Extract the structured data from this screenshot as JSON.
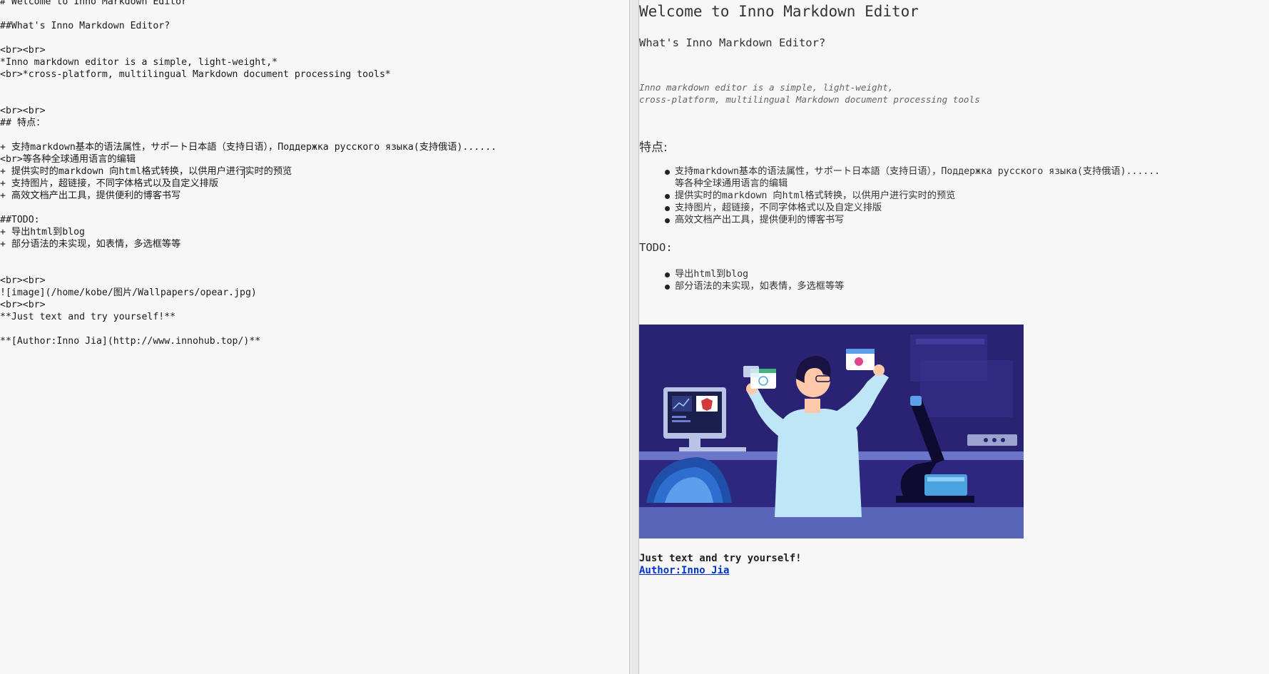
{
  "editor": {
    "lines": [
      "# Welcome to Inno Markdown Editor",
      "",
      "##What's Inno Markdown Editor?",
      "",
      "<br><br>",
      "*Inno markdown editor is a simple, light-weight,*",
      "<br>*cross-platform, multilingual Markdown document processing tools*",
      "",
      "",
      "<br><br>",
      "## 特点：",
      "",
      "+ 支持markdown基本的语法属性，サポート日本語（支持日语），Поддержка русского языка(支持俄语)......",
      "<br>等各种全球通用语言的编辑",
      "+ 提供实时的markdown 向html格式转换，以供用户进行实时的预览",
      "+ 支持图片，超链接，不同字体格式以及自定义排版",
      "+ 高效文档产出工具，提供便利的博客书写",
      "",
      "##TODO:",
      "+ 导出html到blog",
      "+ 部分语法的未实现，如表情，多选框等等",
      "",
      "",
      "<br><br>",
      "![image](/home/kobe/图片/Wallpapers/opear.jpg)",
      "<br><br>",
      "**Just text and try yourself!**",
      "",
      "**[Author:Inno Jia](http://www.innohub.top/)**"
    ]
  },
  "preview": {
    "h1": "Welcome to Inno Markdown Editor",
    "h2_what": "What's Inno Markdown Editor?",
    "em_line1": "Inno markdown editor is a simple, light-weight,",
    "em_line2": "cross-platform, multilingual Markdown document processing tools",
    "features_heading": "特点:",
    "features": [
      "支持markdown基本的语法属性，サポート日本語（支持日语），Поддержка русского языка(支持俄语)......",
      "等各种全球通用语言的编辑",
      "提供实时的markdown 向html格式转换，以供用户进行实时的预览",
      "支持图片，超链接，不同字体格式以及自定义排版",
      "高效文档产出工具，提供便利的博客书写"
    ],
    "todo_heading": "TODO:",
    "todo": [
      "导出html到blog",
      "部分语法的未实现，如表情，多选框等等"
    ],
    "strong_text": "Just text and try yourself!",
    "link_text": "Author:Inno Jia"
  },
  "colors": {
    "bg": "#f7f7f7",
    "link": "#0033cc",
    "image_bg": "#2a2373",
    "image_floor": "#5865b8"
  }
}
